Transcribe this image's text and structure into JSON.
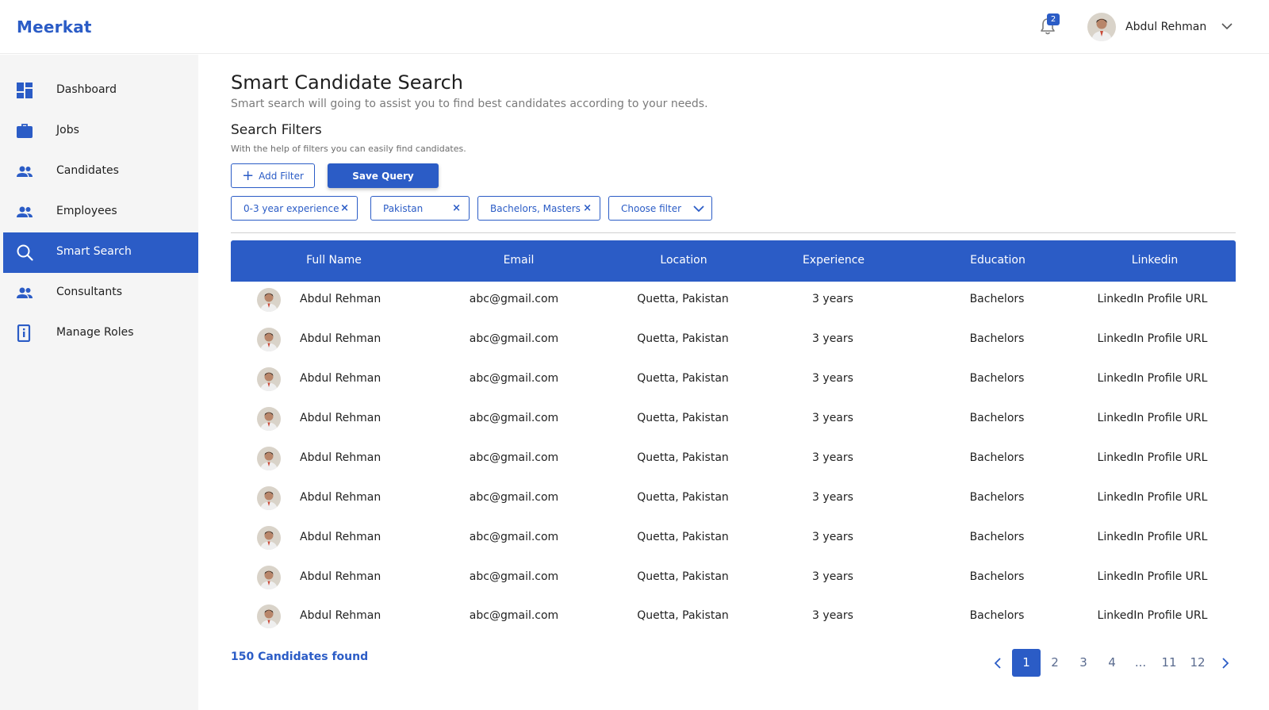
{
  "app": {
    "brand": "Meerkat"
  },
  "header": {
    "notification_count": "2",
    "user_name": "Abdul Rehman"
  },
  "sidebar": {
    "items": [
      {
        "label": "Dashboard",
        "icon": "dashboard-icon"
      },
      {
        "label": "Jobs",
        "icon": "briefcase-icon"
      },
      {
        "label": "Candidates",
        "icon": "people-icon"
      },
      {
        "label": "Employees",
        "icon": "people-icon"
      },
      {
        "label": "Smart Search",
        "icon": "search-icon",
        "active": true
      },
      {
        "label": "Consultants",
        "icon": "people-icon"
      },
      {
        "label": "Manage Roles",
        "icon": "id-badge-icon"
      }
    ]
  },
  "main": {
    "title": "Smart Candidate Search",
    "subtitle": "Smart search will going to assist you to find best candidates according to your needs.",
    "filters_title": "Search Filters",
    "filters_subtitle": "With the help of filters you can easily find candidates.",
    "add_filter_label": "Add Filter",
    "save_query_label": "Save Query",
    "chips": [
      {
        "label": "0-3 year experience"
      },
      {
        "label": "Pakistan"
      },
      {
        "label": "Bachelors, Masters"
      }
    ],
    "choose_filter_label": "Choose filter"
  },
  "table": {
    "columns": [
      "Full Name",
      "Email",
      "Location",
      "Experience",
      "Education",
      "Linkedin"
    ],
    "rows": [
      [
        "Abdul Rehman",
        "abc@gmail.com",
        "Quetta, Pakistan",
        "3 years",
        "Bachelors",
        "LinkedIn Profile URL"
      ],
      [
        "Abdul Rehman",
        "abc@gmail.com",
        "Quetta, Pakistan",
        "3 years",
        "Bachelors",
        "LinkedIn Profile URL"
      ],
      [
        "Abdul Rehman",
        "abc@gmail.com",
        "Quetta, Pakistan",
        "3 years",
        "Bachelors",
        "LinkedIn Profile URL"
      ],
      [
        "Abdul Rehman",
        "abc@gmail.com",
        "Quetta, Pakistan",
        "3 years",
        "Bachelors",
        "LinkedIn Profile URL"
      ],
      [
        "Abdul Rehman",
        "abc@gmail.com",
        "Quetta, Pakistan",
        "3 years",
        "Bachelors",
        "LinkedIn Profile URL"
      ],
      [
        "Abdul Rehman",
        "abc@gmail.com",
        "Quetta, Pakistan",
        "3 years",
        "Bachelors",
        "LinkedIn Profile URL"
      ],
      [
        "Abdul Rehman",
        "abc@gmail.com",
        "Quetta, Pakistan",
        "3 years",
        "Bachelors",
        "LinkedIn Profile URL"
      ],
      [
        "Abdul Rehman",
        "abc@gmail.com",
        "Quetta, Pakistan",
        "3 years",
        "Bachelors",
        "LinkedIn Profile URL"
      ],
      [
        "Abdul Rehman",
        "abc@gmail.com",
        "Quetta, Pakistan",
        "3 years",
        "Bachelors",
        "LinkedIn Profile URL"
      ]
    ]
  },
  "footer": {
    "found_text": "150 Candidates found",
    "pages": [
      "1",
      "2",
      "3",
      "4",
      "...",
      "11",
      "12"
    ],
    "current_page": "1"
  },
  "colors": {
    "accent": "#2b5cc6",
    "sidebar_bg": "#f5f5f5"
  }
}
